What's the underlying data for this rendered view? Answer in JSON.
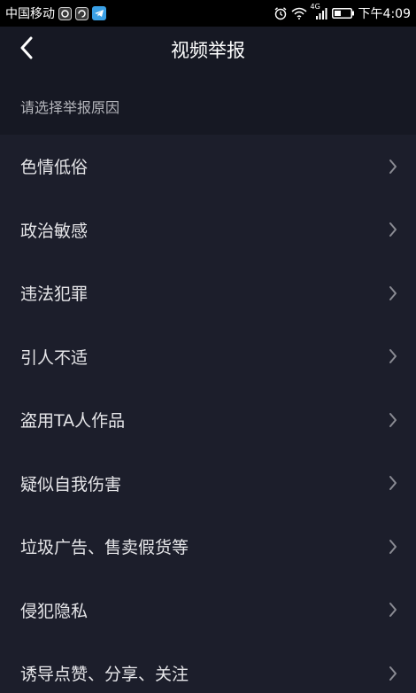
{
  "status_bar": {
    "carrier": "中国移动",
    "network_badge": "4G",
    "time": "下午4:09",
    "icons": [
      "app-notification-icon",
      "sync-icon",
      "telegram-icon",
      "alarm-icon",
      "wifi-icon",
      "signal-icon",
      "battery-icon"
    ]
  },
  "nav": {
    "title": "视频举报",
    "back_icon": "chevron-left-icon"
  },
  "section": {
    "header": "请选择举报原因"
  },
  "reasons": [
    {
      "label": "色情低俗"
    },
    {
      "label": "政治敏感"
    },
    {
      "label": "违法犯罪"
    },
    {
      "label": "引人不适"
    },
    {
      "label": "盗用TA人作品"
    },
    {
      "label": "疑似自我伤害"
    },
    {
      "label": "垃圾广告、售卖假货等"
    },
    {
      "label": "侵犯隐私"
    },
    {
      "label": "诱导点赞、分享、关注"
    }
  ],
  "colors": {
    "background": "#161823",
    "list_background": "#1c1e2b",
    "text": "#e6e6e9",
    "secondary_text": "#b5b6bc",
    "chevron": "#8a8b93"
  }
}
